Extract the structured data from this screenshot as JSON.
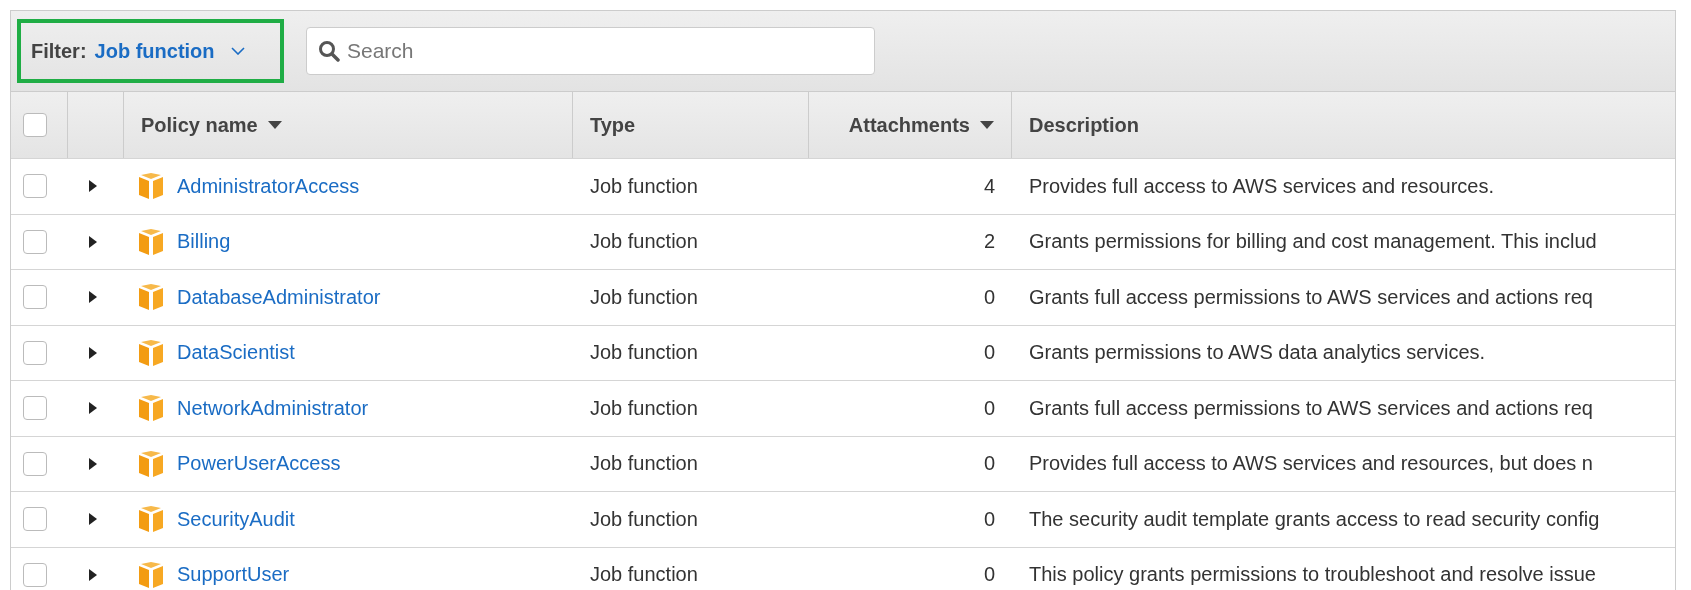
{
  "filter": {
    "label": "Filter:",
    "value": "Job function"
  },
  "search": {
    "placeholder": "Search"
  },
  "table": {
    "select_all_checked": false,
    "columns": [
      {
        "label": "Policy name",
        "sorted": true
      },
      {
        "label": "Type",
        "sorted": false
      },
      {
        "label": "Attachments",
        "sorted": true
      },
      {
        "label": "Description",
        "sorted": false
      }
    ],
    "rows": [
      {
        "checked": false,
        "expanded": false,
        "name": "AdministratorAccess",
        "type": "Job function",
        "attachments": "4",
        "description": "Provides full access to AWS services and resources."
      },
      {
        "checked": false,
        "expanded": false,
        "name": "Billing",
        "type": "Job function",
        "attachments": "2",
        "description": "Grants permissions for billing and cost management. This includ"
      },
      {
        "checked": false,
        "expanded": false,
        "name": "DatabaseAdministrator",
        "type": "Job function",
        "attachments": "0",
        "description": "Grants full access permissions to AWS services and actions req"
      },
      {
        "checked": false,
        "expanded": false,
        "name": "DataScientist",
        "type": "Job function",
        "attachments": "0",
        "description": "Grants permissions to AWS data analytics services."
      },
      {
        "checked": false,
        "expanded": false,
        "name": "NetworkAdministrator",
        "type": "Job function",
        "attachments": "0",
        "description": "Grants full access permissions to AWS services and actions req"
      },
      {
        "checked": false,
        "expanded": false,
        "name": "PowerUserAccess",
        "type": "Job function",
        "attachments": "0",
        "description": "Provides full access to AWS services and resources, but does n"
      },
      {
        "checked": false,
        "expanded": false,
        "name": "SecurityAudit",
        "type": "Job function",
        "attachments": "0",
        "description": "The security audit template grants access to read security config"
      },
      {
        "checked": false,
        "expanded": false,
        "name": "SupportUser",
        "type": "Job function",
        "attachments": "0",
        "description": "This policy grants permissions to troubleshoot and resolve issue"
      }
    ]
  }
}
